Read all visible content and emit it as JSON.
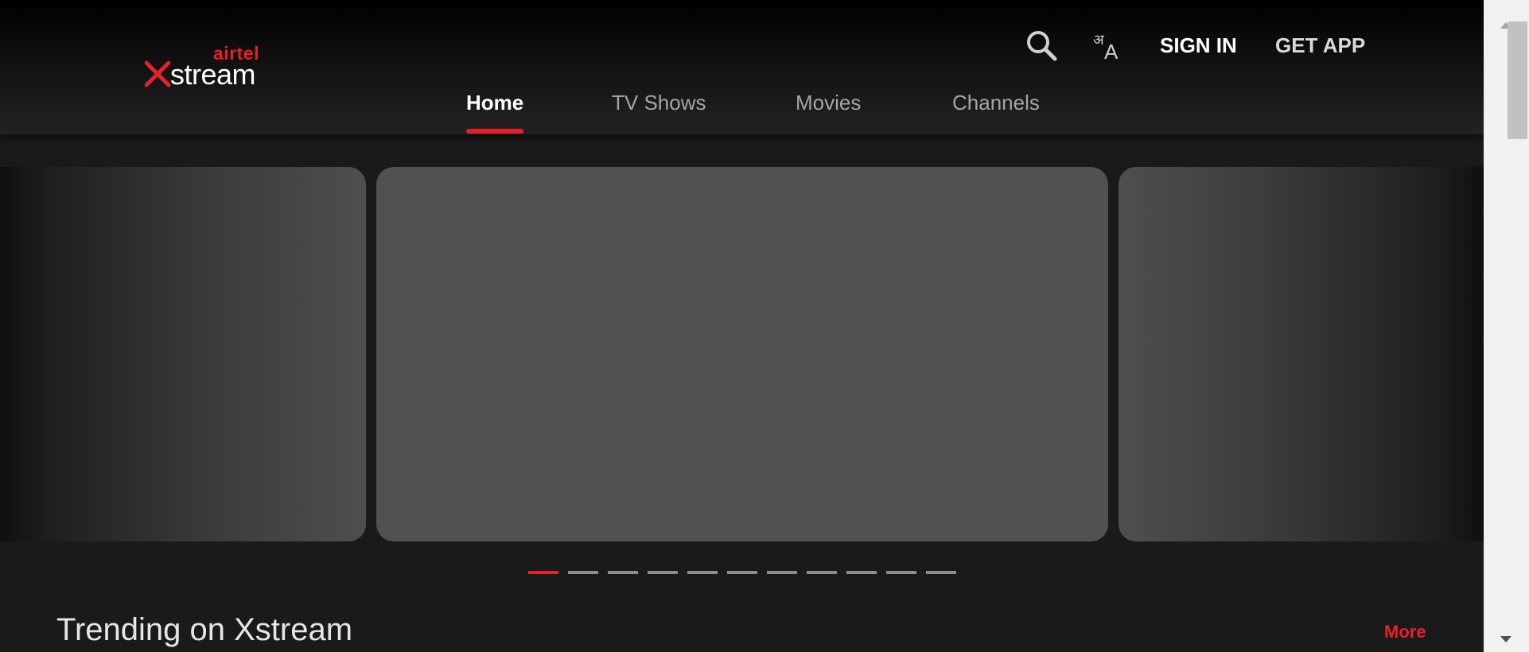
{
  "brand": {
    "airtel": "airtel",
    "stream": "stream",
    "accent_color": "#e8202a"
  },
  "header": {
    "search_icon": "search-icon",
    "language_icon": "language-icon",
    "sign_in_label": "SIGN IN",
    "get_app_label": "GET APP"
  },
  "nav": {
    "tabs": [
      {
        "label": "Home",
        "active": true
      },
      {
        "label": "TV Shows",
        "active": false
      },
      {
        "label": "Movies",
        "active": false
      },
      {
        "label": "Channels",
        "active": false
      }
    ]
  },
  "carousel": {
    "slide_count": 11,
    "active_index": 0
  },
  "section": {
    "title": "Trending on Xstream",
    "more_label": "More"
  }
}
